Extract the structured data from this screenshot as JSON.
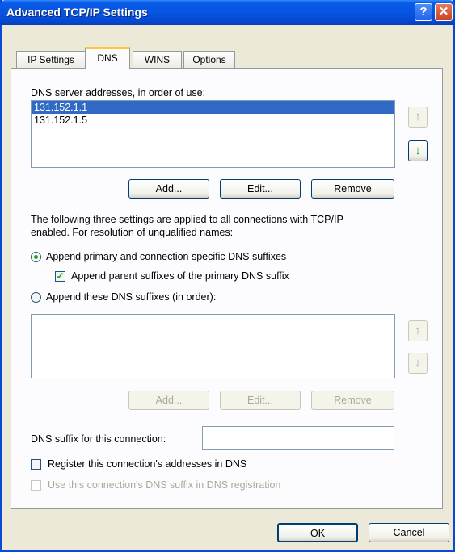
{
  "window": {
    "title": "Advanced TCP/IP Settings",
    "help_glyph": "?",
    "close_glyph": "✕"
  },
  "tabs": [
    {
      "label": "IP Settings",
      "active": false
    },
    {
      "label": "DNS",
      "active": true
    },
    {
      "label": "WINS",
      "active": false
    },
    {
      "label": "Options",
      "active": false
    }
  ],
  "dns_servers": {
    "label": "DNS server addresses, in order of use:",
    "items": [
      "131.152.1.1",
      "131.152.1.5"
    ],
    "selected_index": 0,
    "up_icon": "up-arrow-icon",
    "down_icon": "down-arrow-icon",
    "up_glyph": "↑",
    "down_glyph": "↓",
    "add_label": "Add...",
    "edit_label": "Edit...",
    "remove_label": "Remove"
  },
  "resolution": {
    "info_line1": "The following three settings are applied to all connections with TCP/IP",
    "info_line2": "enabled. For resolution of unqualified names:",
    "radio_primary_label": "Append primary and connection specific DNS suffixes",
    "radio_primary_checked": true,
    "checkbox_parent_label": "Append parent suffixes of the primary DNS suffix",
    "checkbox_parent_checked": true,
    "radio_these_label": "Append these DNS suffixes (in order):",
    "radio_these_checked": false
  },
  "suffix_list": {
    "items": [],
    "add_label": "Add...",
    "edit_label": "Edit...",
    "remove_label": "Remove",
    "up_glyph": "↑",
    "down_glyph": "↓"
  },
  "connection": {
    "suffix_label": "DNS suffix for this connection:",
    "suffix_value": "",
    "register_label": "Register this connection's addresses in DNS",
    "register_checked": false,
    "use_suffix_label": "Use this connection's DNS suffix in DNS registration",
    "use_suffix_checked": false
  },
  "footer": {
    "ok_label": "OK",
    "cancel_label": "Cancel"
  },
  "colors": {
    "title_blue": "#0755E0",
    "selection": "#316AC5",
    "tab_highlight": "#FFC83C",
    "arrow_green": "#109E18",
    "dialog_bg": "#ECE9D8"
  }
}
